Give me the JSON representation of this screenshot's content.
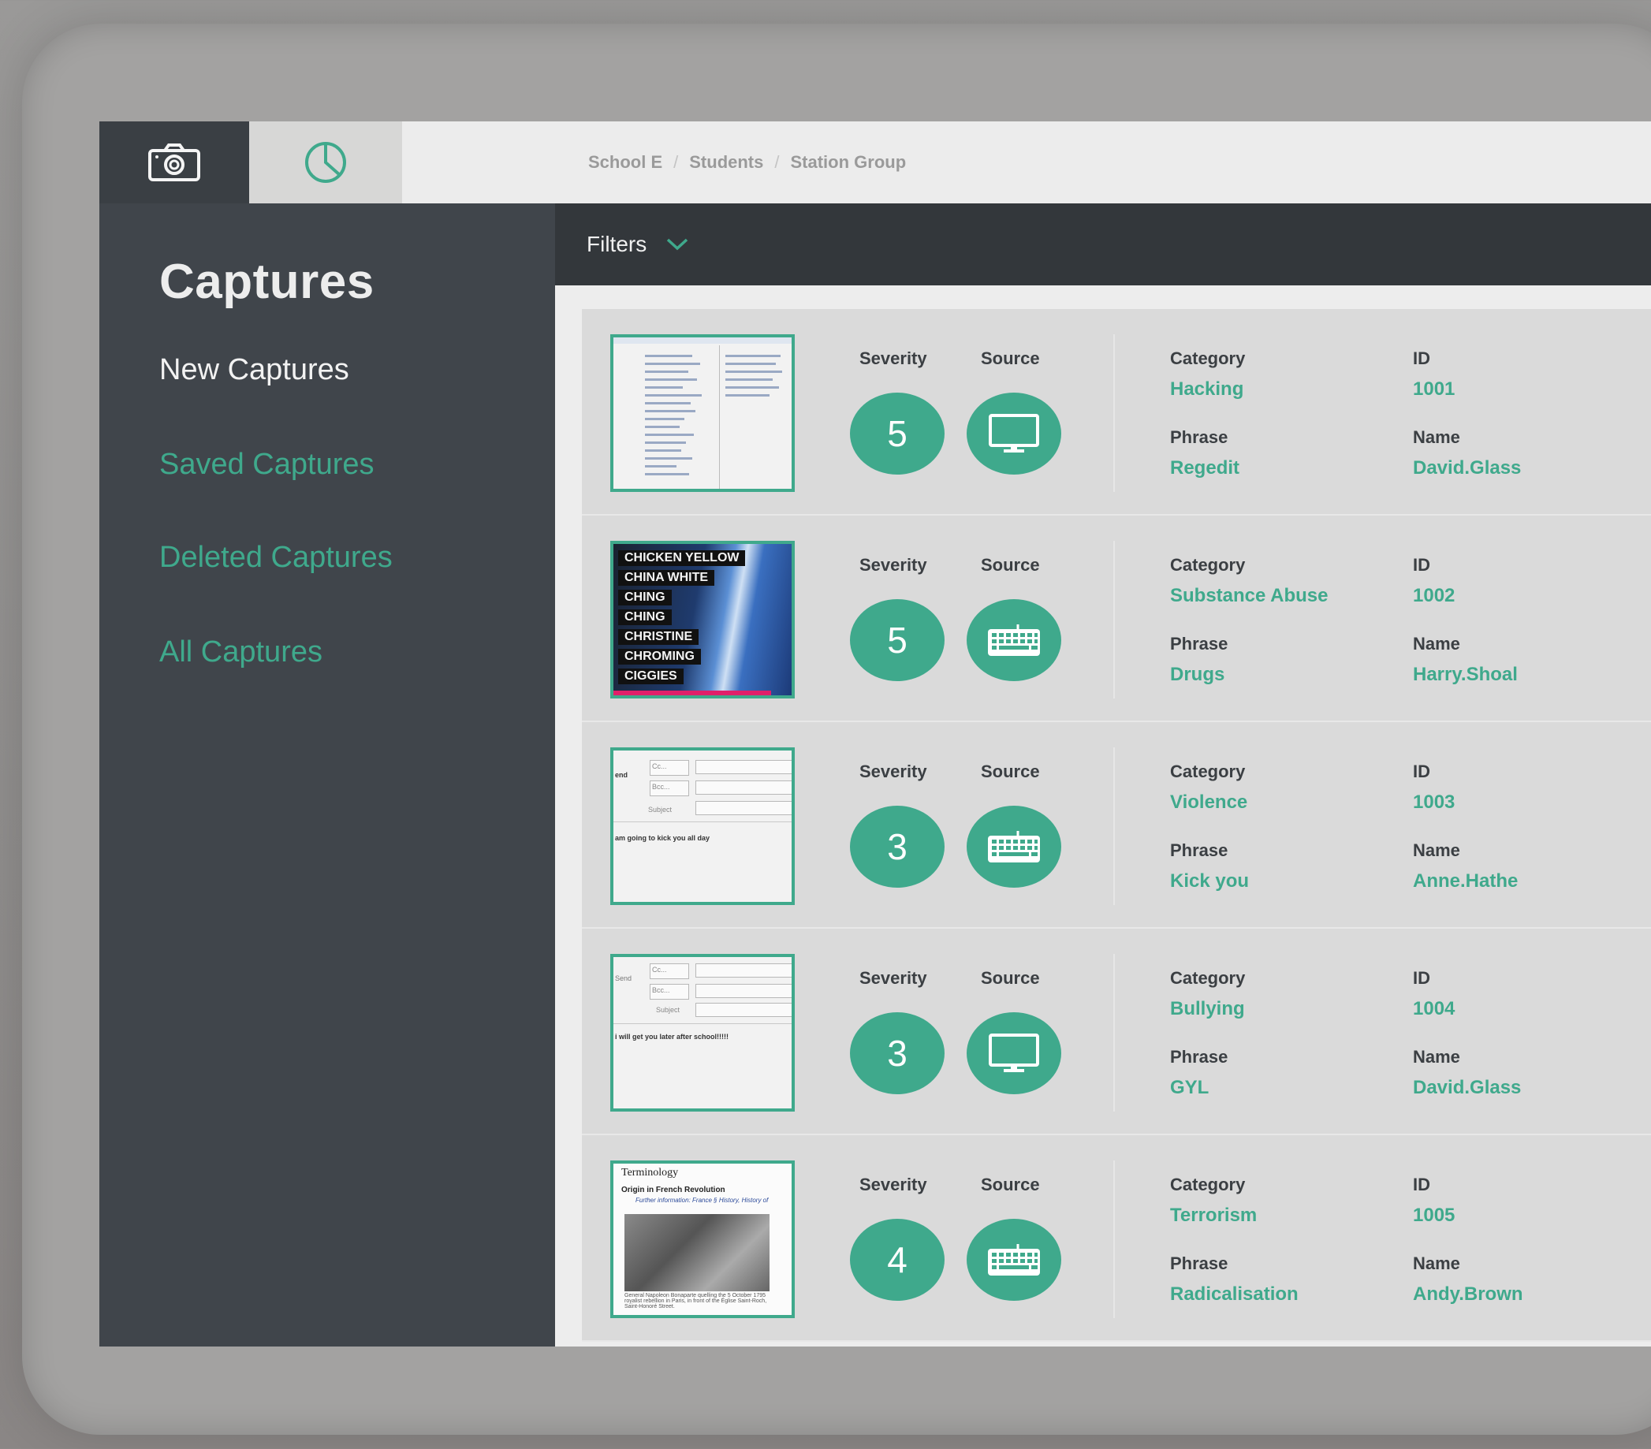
{
  "topbar": {
    "tabs": [
      {
        "icon": "camera-icon",
        "active": true
      },
      {
        "icon": "pie-chart-icon",
        "active": false
      }
    ],
    "breadcrumb": [
      "School E",
      "Students",
      "Station Group"
    ],
    "separator": "/"
  },
  "sidebar": {
    "title": "Captures",
    "items": [
      {
        "label": "New Captures",
        "active": true
      },
      {
        "label": "Saved Captures",
        "active": false
      },
      {
        "label": "Deleted Captures",
        "active": false
      },
      {
        "label": "All Captures",
        "active": false
      }
    ]
  },
  "filters": {
    "label": "Filters"
  },
  "labels": {
    "severity": "Severity",
    "source": "Source",
    "category": "Category",
    "id": "ID",
    "phrase": "Phrase",
    "name": "Name"
  },
  "captures": [
    {
      "severity": "5",
      "source": "monitor-icon",
      "category": "Hacking",
      "id": "1001",
      "phrase": "Regedit",
      "name": "David.Glass",
      "thumbnail": "registry-editor"
    },
    {
      "severity": "5",
      "source": "keyboard-icon",
      "category": "Substance Abuse",
      "id": "1002",
      "phrase": "Drugs",
      "name": "Harry.Shoal",
      "thumbnail": "slang-list"
    },
    {
      "severity": "3",
      "source": "keyboard-icon",
      "category": "Violence",
      "id": "1003",
      "phrase": "Kick you",
      "name": "Anne.Hathe",
      "thumbnail": "email-compose"
    },
    {
      "severity": "3",
      "source": "monitor-icon",
      "category": "Bullying",
      "id": "1004",
      "phrase": "GYL",
      "name": "David.Glass",
      "thumbnail": "email-compose"
    },
    {
      "severity": "4",
      "source": "keyboard-icon",
      "category": "Terrorism",
      "id": "1005",
      "phrase": "Radicalisation",
      "name": "Andy.Brown",
      "thumbnail": "wiki-article"
    }
  ],
  "thumbnails": {
    "slang_words": [
      "CHICKEN YELLOW",
      "CHINA WHITE",
      "CHING",
      "CHING",
      "CHRISTINE",
      "CHROMING",
      "CIGGIES"
    ],
    "email1": {
      "cc": "Cc...",
      "bcc": "Bcc...",
      "subject": "Subject",
      "send": "end",
      "body": "am going to kick you all day"
    },
    "email2": {
      "cc": "Cc...",
      "bcc": "Bcc...",
      "subject": "Subject",
      "send": "Send",
      "body": "i will get you later after school!!!!!"
    },
    "wiki": {
      "title": "Terminology",
      "subtitle": "Origin in French Revolution",
      "info": "Further information: France § History, History of",
      "caption": "General Napoleon Bonaparte quelling the 5 October 1795 royalist rebellion in Paris, in front of the Église Saint-Roch, Saint-Honoré Street."
    }
  },
  "colors": {
    "accent": "#3fa98c",
    "sidebar": "#40454b",
    "filterbar": "#33373b"
  }
}
